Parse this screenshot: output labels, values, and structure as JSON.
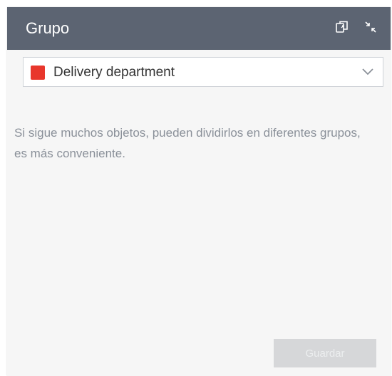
{
  "panel": {
    "title": "Grupo"
  },
  "header_icons": {
    "copy": "copy-icon",
    "collapse": "collapse-arrows-icon"
  },
  "group_select": {
    "selected_label": "Delivery department",
    "swatch_color": "#e8372c",
    "chevron": "chevron-down-icon"
  },
  "description": "Si sigue muchos objetos, pueden dividirlos en diferentes grupos, es más conveniente.",
  "actions": {
    "save_label": "Guardar"
  },
  "colors": {
    "header_bg": "#5c6472",
    "panel_bg": "#f6f6f6",
    "button_disabled_bg": "#d6d7d9"
  }
}
